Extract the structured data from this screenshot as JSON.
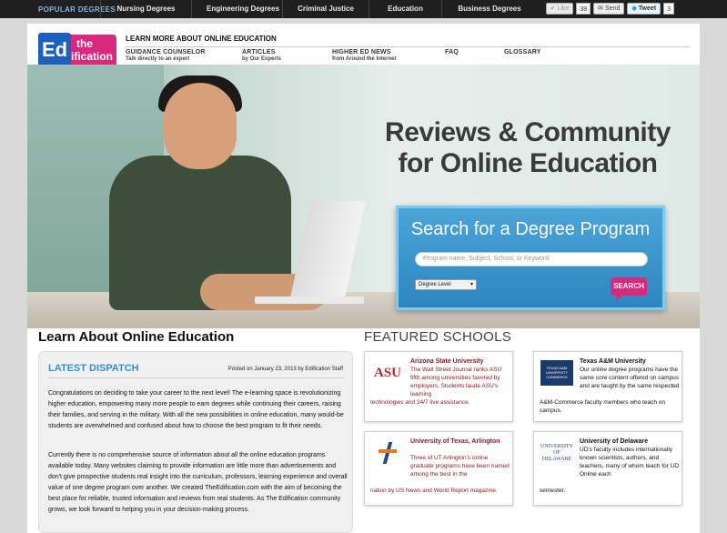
{
  "topbar": {
    "popular": "POPULAR DEGREES",
    "links": [
      "Nursing Degrees",
      "Engineering Degrees",
      "Criminal Justice",
      "Education",
      "Business Degrees"
    ],
    "like_label": "Like",
    "like_count": "38",
    "send_label": "Send",
    "tweet_label": "Tweet",
    "tweet_count": "3"
  },
  "logo": {
    "ed": "Ed",
    "the": "the",
    "ification": "ification"
  },
  "header": {
    "learn_more": "LEARN MORE ABOUT ONLINE EDUCATION",
    "nav": [
      {
        "title": "GUIDANCE COUNSELOR",
        "desc": "Talk directly to an expert"
      },
      {
        "title": "ARTICLES",
        "desc": "by Our Experts"
      },
      {
        "title": "HIGHER ED NEWS",
        "desc": "from Around the Internet"
      },
      {
        "title": "FAQ",
        "desc": ""
      },
      {
        "title": "GLOSSARY",
        "desc": ""
      }
    ]
  },
  "hero": {
    "headline_line1": "Reviews & Community",
    "headline_line2": "for Online Education",
    "search_title": "Search for a Degree Program",
    "search_placeholder": "Program name, Subject, School, or Keyword",
    "degree_level": "Degree Level",
    "search_button": "SEARCH"
  },
  "main": {
    "learn_title": "Learn About Online Education",
    "featured_title": "FEATURED SCHOOLS",
    "dispatch": {
      "title": "LATEST DISPATCH",
      "posted": "Posted on January 23, 2013 by Edification Staff",
      "para1": "Congratulations on deciding to take your career to the next level! The e-learning space is revolutionizing higher education, empowering many more people to earn degrees while continuing their careers, raising their families, and serving in the military. With all the new possibilities in online education, many would-be students are overwhelmed and confused about how to choose the best program to fit their needs.",
      "para2": "Currently there is no comprehensive source of information about all the online education programs available today. Many websites claiming to provide information are little more than advertisements and don't give prospective students real insight into the curriculum, professors, learning experience and overall value of one degree program over another. We created TheEdification.com with the aim of becoming the best place for reliable, trusted information and reviews from real students. As The Edification community grows, we look forward to helping you in your decision-making process."
    }
  },
  "schools": [
    {
      "name": "Arizona State University",
      "logo": "ASU",
      "desc_top": "The Wall Street Journal ranks ASU fifth among universities favored by employers. Students laude ASU's learning",
      "desc_bottom": "technologies and 24/7 live assistance."
    },
    {
      "name": "Texas A&M University",
      "logo": "TEXAS A&M UNIVERSITY COMMERCE",
      "desc_top": "Our online degree programs have the same core content offered on campus and are taught by the same respected",
      "desc_bottom": "A&M-Commerce faculty members who teach on campus."
    },
    {
      "name": "University of Texas, Arlington",
      "logo": "UTA",
      "desc_top": "Three of UT Arlington's online graduate programs have been named among the best in the",
      "desc_bottom": "nation by US News and World Report magazine."
    },
    {
      "name": "University of Delaware",
      "logo": "UNIVERSITY OF DELAWARE",
      "desc_top": "UD's faculty includes internationally known scientists, authors, and teachers, many of whom teach for UD Online each",
      "desc_bottom": "semester."
    }
  ]
}
